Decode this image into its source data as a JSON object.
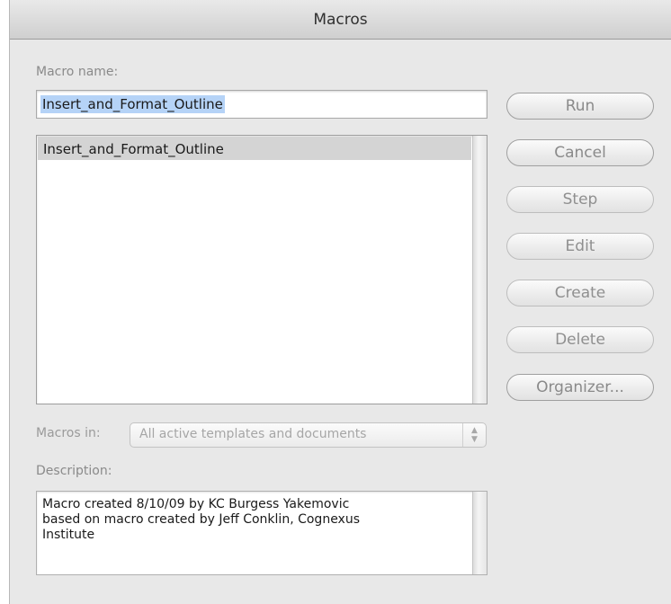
{
  "window": {
    "title": "Macros"
  },
  "macro_name": {
    "label": "Macro name:",
    "value": "Insert_and_Format_Outline"
  },
  "macro_list": {
    "items": [
      "Insert_and_Format_Outline"
    ],
    "selected": "Insert_and_Format_Outline"
  },
  "buttons": {
    "run": "Run",
    "cancel": "Cancel",
    "step": "Step",
    "edit": "Edit",
    "create": "Create",
    "delete": "Delete",
    "organizer": "Organizer..."
  },
  "macros_in": {
    "label": "Macros in:",
    "selected": "All active templates and documents"
  },
  "description": {
    "label": "Description:",
    "lines": [
      "Macro created 8/10/09 by KC Burgess Yakemovic",
      "based on macro created by Jeff Conklin, Cognexus",
      "Institute"
    ]
  },
  "icons": {
    "popup_arrows": "up-down-chevron-icon"
  },
  "colors": {
    "selection": "#b5d3f7",
    "list_highlight": "#d4d4d4"
  }
}
